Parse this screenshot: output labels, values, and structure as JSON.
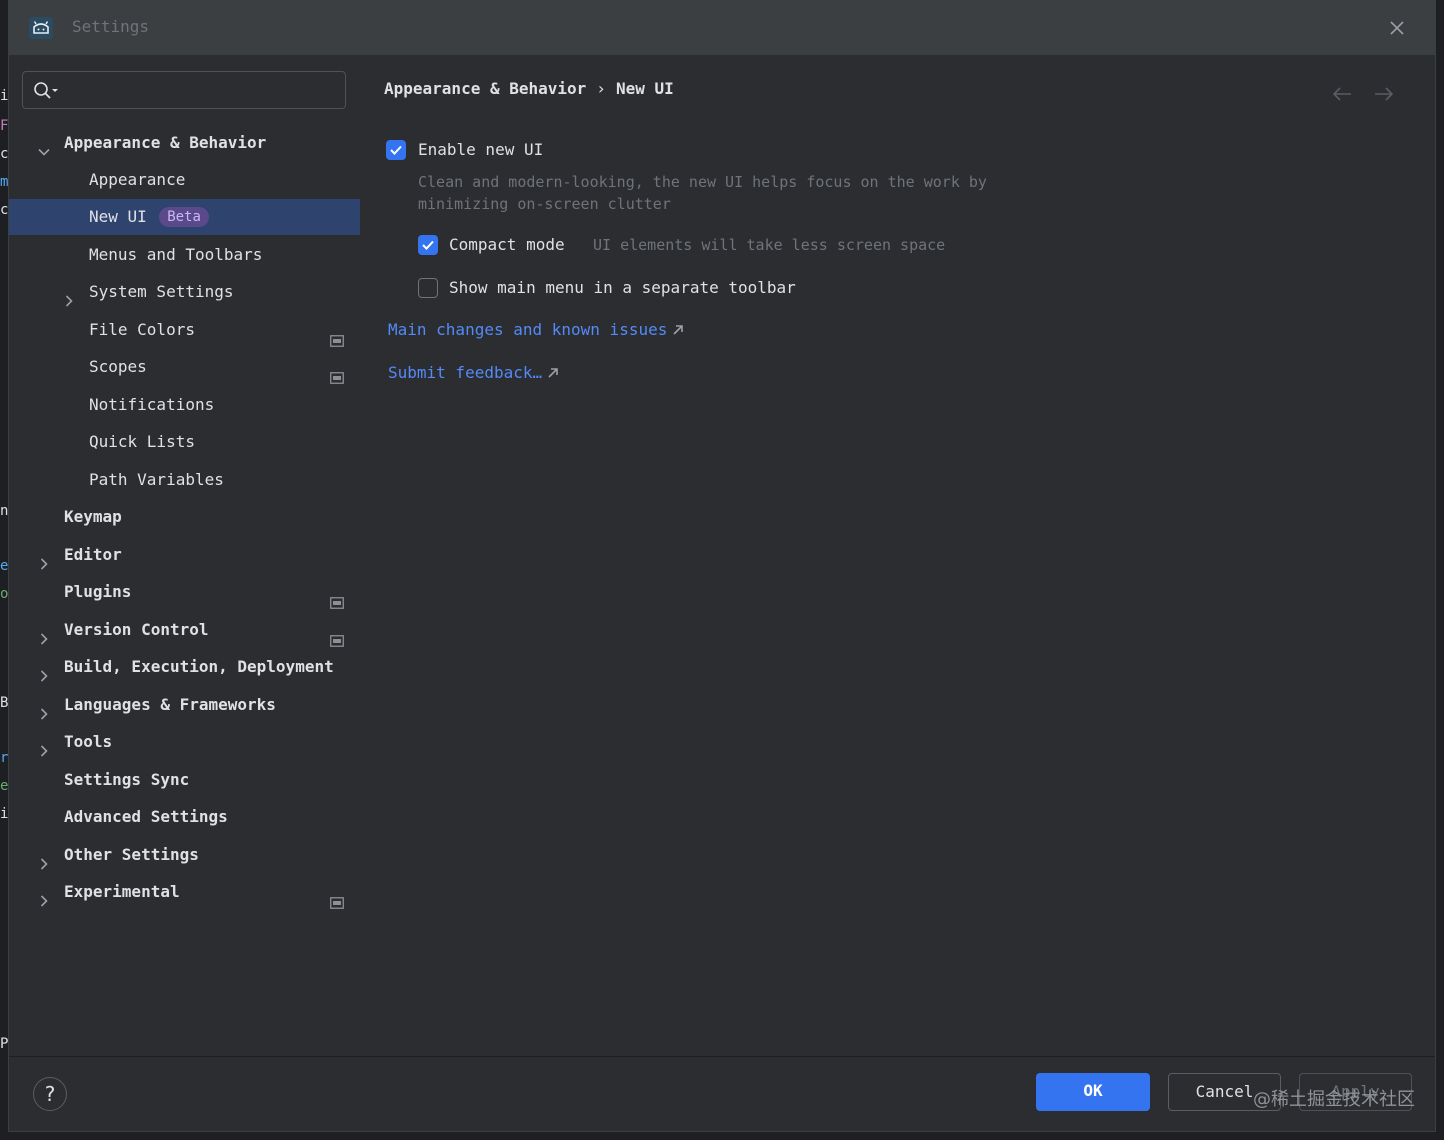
{
  "window": {
    "title": "Settings"
  },
  "search": {
    "placeholder": ""
  },
  "background_editor": {
    "fragments": [
      "i",
      "F",
      "c",
      "m",
      "c",
      "n",
      "e",
      "o",
      "B",
      "r",
      "e",
      "i",
      "P"
    ]
  },
  "sidebar": {
    "items": [
      {
        "label": "Appearance & Behavior",
        "level": 0,
        "expandable": true,
        "expanded": true,
        "bold": true
      },
      {
        "label": "Appearance",
        "level": 1,
        "expandable": false
      },
      {
        "label": "New UI",
        "level": 1,
        "expandable": false,
        "selected": true,
        "badge": "Beta"
      },
      {
        "label": "Menus and Toolbars",
        "level": 1,
        "expandable": false
      },
      {
        "label": "System Settings",
        "level": 1,
        "expandable": true,
        "expanded": false
      },
      {
        "label": "File Colors",
        "level": 1,
        "expandable": false,
        "project_icon": true
      },
      {
        "label": "Scopes",
        "level": 1,
        "expandable": false,
        "project_icon": true
      },
      {
        "label": "Notifications",
        "level": 1,
        "expandable": false
      },
      {
        "label": "Quick Lists",
        "level": 1,
        "expandable": false
      },
      {
        "label": "Path Variables",
        "level": 1,
        "expandable": false
      },
      {
        "label": "Keymap",
        "level": 0,
        "expandable": false,
        "bold": true
      },
      {
        "label": "Editor",
        "level": 0,
        "expandable": true,
        "expanded": false,
        "bold": true
      },
      {
        "label": "Plugins",
        "level": 0,
        "expandable": false,
        "bold": true,
        "project_icon": true
      },
      {
        "label": "Version Control",
        "level": 0,
        "expandable": true,
        "expanded": false,
        "bold": true,
        "project_icon": true
      },
      {
        "label": "Build, Execution, Deployment",
        "level": 0,
        "expandable": true,
        "expanded": false,
        "bold": true
      },
      {
        "label": "Languages & Frameworks",
        "level": 0,
        "expandable": true,
        "expanded": false,
        "bold": true
      },
      {
        "label": "Tools",
        "level": 0,
        "expandable": true,
        "expanded": false,
        "bold": true
      },
      {
        "label": "Settings Sync",
        "level": 0,
        "expandable": false,
        "bold": true
      },
      {
        "label": "Advanced Settings",
        "level": 0,
        "expandable": false,
        "bold": true
      },
      {
        "label": "Other Settings",
        "level": 0,
        "expandable": true,
        "expanded": false,
        "bold": true
      },
      {
        "label": "Experimental",
        "level": 0,
        "expandable": true,
        "expanded": false,
        "bold": true,
        "project_icon": true
      }
    ]
  },
  "breadcrumb": {
    "parent": "Appearance & Behavior",
    "separator": "›",
    "current": "New UI"
  },
  "options": {
    "enable_new_ui": {
      "label": "Enable new UI",
      "checked": true,
      "description": "Clean and modern-looking, the new UI helps focus on the work by minimizing on-screen clutter"
    },
    "compact_mode": {
      "label": "Compact mode",
      "checked": true,
      "hint": "UI elements will take less screen space"
    },
    "separate_toolbar": {
      "label": "Show main menu in a separate toolbar",
      "checked": false
    }
  },
  "links": {
    "main_changes": "Main changes and known issues",
    "submit_feedback": "Submit feedback…"
  },
  "footer": {
    "help": "?",
    "ok": "OK",
    "cancel": "Cancel",
    "apply": "Apply",
    "watermark": "@稀土掘金技术社区"
  },
  "colors": {
    "accent": "#3574f0",
    "link": "#548af7",
    "selection": "#2e436e",
    "badge_bg": "#5a4a8c",
    "badge_fg": "#c9b9f2",
    "panel_bg": "#2b2d30",
    "titlebar_bg": "#3c3f41"
  }
}
